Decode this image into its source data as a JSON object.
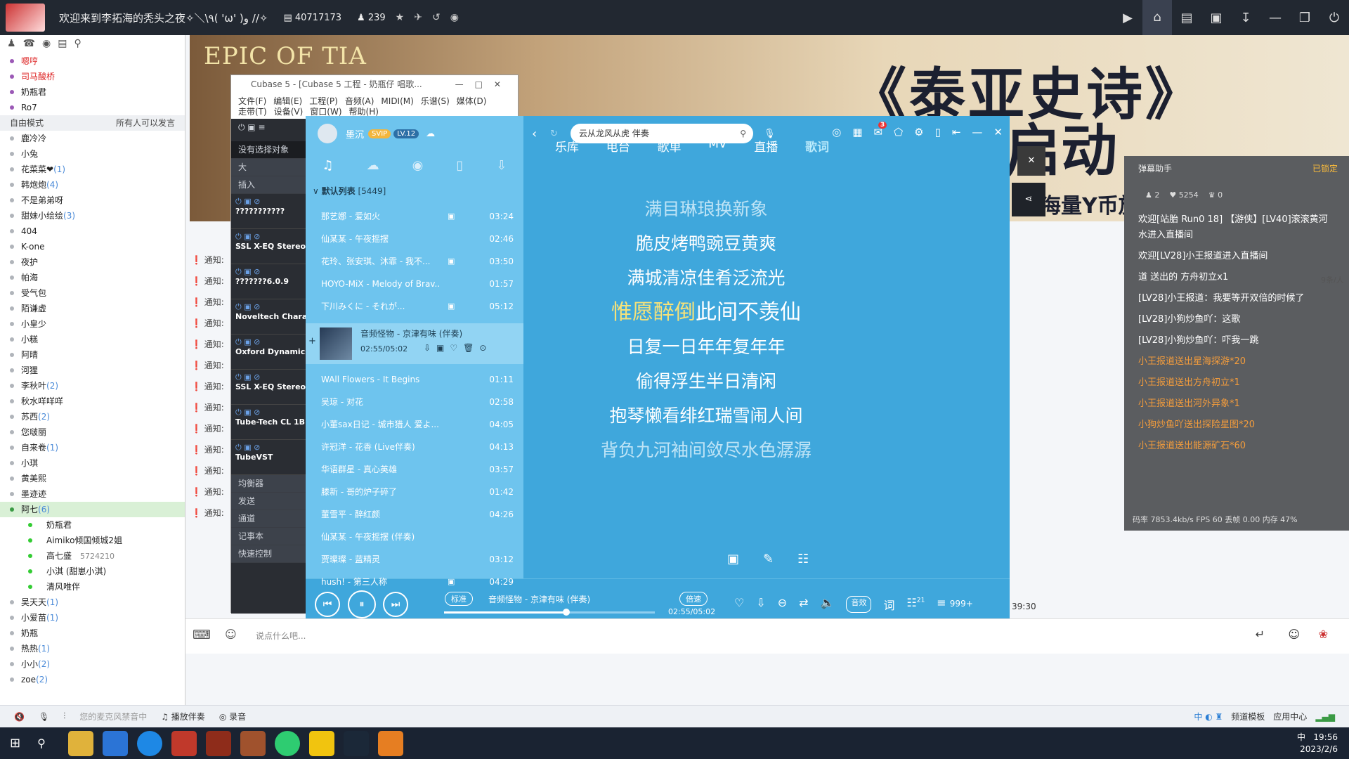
{
  "topbar": {
    "title": "欢迎来到李拓海的秃头之夜✧＼\\٩( 'ω' )و //✧",
    "channel_id": "40717173",
    "users": "239"
  },
  "left": {
    "users_top": [
      "嗯哼",
      "司马酸桥",
      "奶瓶君",
      "Ro7"
    ],
    "mode": "自由模式",
    "mode_right": "所有人可以发言",
    "users": [
      {
        "name": "鹿冷冷",
        "count": ""
      },
      {
        "name": "小兔",
        "count": ""
      },
      {
        "name": "花菜菜❤",
        "count": "(1)"
      },
      {
        "name": "韩炮炮",
        "count": "(4)"
      },
      {
        "name": "不是弟弟呀",
        "count": ""
      },
      {
        "name": "甜妹小绘绘",
        "count": "(3)"
      },
      {
        "name": "404",
        "count": ""
      },
      {
        "name": "K-one",
        "count": ""
      },
      {
        "name": "夜护",
        "count": ""
      },
      {
        "name": "帕海",
        "count": ""
      },
      {
        "name": "受气包",
        "count": ""
      },
      {
        "name": "陌谦虚",
        "count": ""
      },
      {
        "name": "小皇少",
        "count": ""
      },
      {
        "name": "小糕",
        "count": ""
      },
      {
        "name": "阿晴",
        "count": ""
      },
      {
        "name": "河狸",
        "count": ""
      },
      {
        "name": "李秋叶",
        "count": "(2)"
      },
      {
        "name": "秋水咩咩咩",
        "count": ""
      },
      {
        "name": "苏西",
        "count": "(2)"
      },
      {
        "name": "您啵丽",
        "count": ""
      },
      {
        "name": "自来卷",
        "count": "(1)"
      },
      {
        "name": "小琪",
        "count": ""
      },
      {
        "name": "黄美熙",
        "count": ""
      },
      {
        "name": "墨迹迹",
        "count": ""
      }
    ],
    "group_sel": {
      "name": "阿七",
      "count": "(6)"
    },
    "group_members": [
      "奶瓶君",
      "Aimiko倾国倾城2姐",
      "高七盛",
      "小淇 (甜崽小淇)",
      "清风唯伴"
    ],
    "group_member_extra": "5724210",
    "users_bottom": [
      {
        "name": "吴天天",
        "count": "(1)"
      },
      {
        "name": "小爱苗",
        "count": "(1)"
      },
      {
        "name": "奶瓶",
        "count": ""
      },
      {
        "name": "热热",
        "count": "(1)"
      },
      {
        "name": "小小",
        "count": "(2)"
      },
      {
        "name": "zoe",
        "count": "(2)"
      }
    ]
  },
  "notices": [
    "通知:",
    "通知:",
    "通知:",
    "通知:",
    "通知:",
    "通知:",
    "通知:",
    "通知:",
    "通知:",
    "通知:",
    "通知:",
    "通知:",
    "通知:"
  ],
  "cubase": {
    "title": "Cubase 5 - [Cubase 5 工程 - 奶瓶仔 唱歌...",
    "menu1": [
      "文件(F)",
      "编辑(E)",
      "工程(P)",
      "音频(A)",
      "MIDI(M)",
      "乐谱(S)",
      "媒体(D)"
    ],
    "menu2": [
      "走带(T)",
      "设备(V)",
      "窗口(W)",
      "帮助(H)"
    ],
    "panel_title": "没有选择对象",
    "items_top": [
      "大",
      "插入"
    ],
    "plugins": [
      "???????????",
      "SSL X-EQ Stereo",
      "???????6.0.9",
      "Noveltech Charact",
      "Oxford Dynamics",
      "SSL X-EQ Stereo",
      "Tube-Tech CL 1B",
      "TubeVST"
    ],
    "items_bottom": [
      "均衡器",
      "发送",
      "通道",
      "记事本",
      "快速控制"
    ]
  },
  "music": {
    "user": "墨沉",
    "vip": "SVIP",
    "level": "LV.12",
    "search": "云从龙风从虎 伴奏",
    "list_header": "默认列表",
    "list_count": "[5449]",
    "songs": [
      {
        "t": "那艺娜 - 爱如火",
        "d": "03:24",
        "mv": true
      },
      {
        "t": "仙某某 - 午夜摇摆",
        "d": "02:46",
        "mv": false
      },
      {
        "t": "花玲、张安琪、沐霏 - 我不...",
        "d": "03:50",
        "mv": true
      },
      {
        "t": "HOYO-MiX - Melody of Brav...",
        "d": "01:57",
        "mv": false
      },
      {
        "t": "下川みくに - それが...",
        "d": "05:12",
        "mv": true
      }
    ],
    "current": {
      "t": "音频怪物 - 京津有味 (伴奏)",
      "pos": "02:55/05:02"
    },
    "songs2": [
      {
        "t": "WAll Flowers - It Begins",
        "d": "01:11",
        "mv": false
      },
      {
        "t": "吴琼 - 对花",
        "d": "02:58",
        "mv": false
      },
      {
        "t": "小董sax日记 - 城市猎人 爱よ...",
        "d": "04:05",
        "mv": false
      },
      {
        "t": "许冠洋 - 花香 (Live伴奏)",
        "d": "04:13",
        "mv": false
      },
      {
        "t": "华语群星 - 真心英雄",
        "d": "03:57",
        "mv": false
      },
      {
        "t": "滕新 - 哥的炉子碎了",
        "d": "01:42",
        "mv": false
      },
      {
        "t": "董雪平 - 醉红颜",
        "d": "04:26",
        "mv": false
      },
      {
        "t": "仙某某 - 午夜摇摆 (伴奏)",
        "d": "",
        "mv": false
      },
      {
        "t": "贾璨璨 - 蓝精灵",
        "d": "03:12",
        "mv": false
      },
      {
        "t": "hush! - 第三人称",
        "d": "04:29",
        "mv": true
      }
    ],
    "nav": [
      "乐库",
      "电台",
      "歌单",
      "MV",
      "直播",
      "歌词"
    ],
    "lyrics": [
      "满目琳琅换新象",
      "脆皮烤鸭豌豆黄爽",
      "满城清凉佳肴泛流光",
      "",
      "日复一日年年复年年",
      "偷得浮生半日清闲",
      "抱琴懒看绯红瑞雪闹人间",
      "背负九河袖间敛尽水色潺潺"
    ],
    "hl_lyric_a": "惟愿醉倒",
    "hl_lyric_b": "此间不羡仙",
    "badge": "3",
    "player": {
      "quality": "标准",
      "track": "音频怪物 - 京津有味 (伴奏)",
      "speed": "倍速",
      "time": "02:55/05:02",
      "progress": 0.58,
      "effect": "音效",
      "lyric": "词",
      "comments": "21",
      "playlist": "999+"
    }
  },
  "video": {
    "game_logo": "EPIC OF TIA",
    "headline": "《泰亚史诗》",
    "headline2": "版本启动",
    "sub": "海量Y币放送",
    "timer": "39:30"
  },
  "chat": {
    "title": "弹幕助手",
    "locked": "已锁定",
    "stats": [
      "2",
      "5254",
      "0"
    ],
    "messages": [
      {
        "text": "欢迎[站胎 Run0 18] 【游侠】[LV40]滚滚黄河水进入直播间",
        "color": "#ffffff"
      },
      {
        "text": "欢迎[LV28]小王报道进入直播间",
        "color": "#ffffff"
      },
      {
        "text": "道 送出的 方舟初立x1",
        "color": "#ffffff"
      },
      {
        "text": "[LV28]小王报道：我要等开双倍的时候了",
        "color": "#ffffff"
      },
      {
        "text": "[LV28]小狗炒鱼吖：这歌",
        "color": "#ffffff"
      },
      {
        "text": "[LV28]小狗炒鱼吖：吓我一跳",
        "color": "#ffffff"
      },
      {
        "text": "小王报道送出星海探游*20",
        "color": "#f39c3c"
      },
      {
        "text": "小王报道送出方舟初立*1",
        "color": "#f39c3c"
      },
      {
        "text": "小王报道送出河外异象*1",
        "color": "#f39c3c"
      },
      {
        "text": "小狗炒鱼吖送出探险星图*20",
        "color": "#f39c3c"
      },
      {
        "text": "小王报道送出能源矿石*60",
        "color": "#f39c3c"
      }
    ],
    "footer": "码率 7853.4kb/s FPS 60 丢帧 0.00 内存 47%",
    "side_tag": "9条/人"
  },
  "inputbar": {
    "placeholder": "说点什么吧..."
  },
  "statusbar": {
    "mic": "您的麦克风禁音中",
    "accompany": "播放伴奏",
    "record": "录音",
    "template": "频道模板",
    "app_center": "应用中心"
  },
  "taskbar": {
    "time": "19:56",
    "date": "2023/2/6",
    "ime": "中"
  }
}
